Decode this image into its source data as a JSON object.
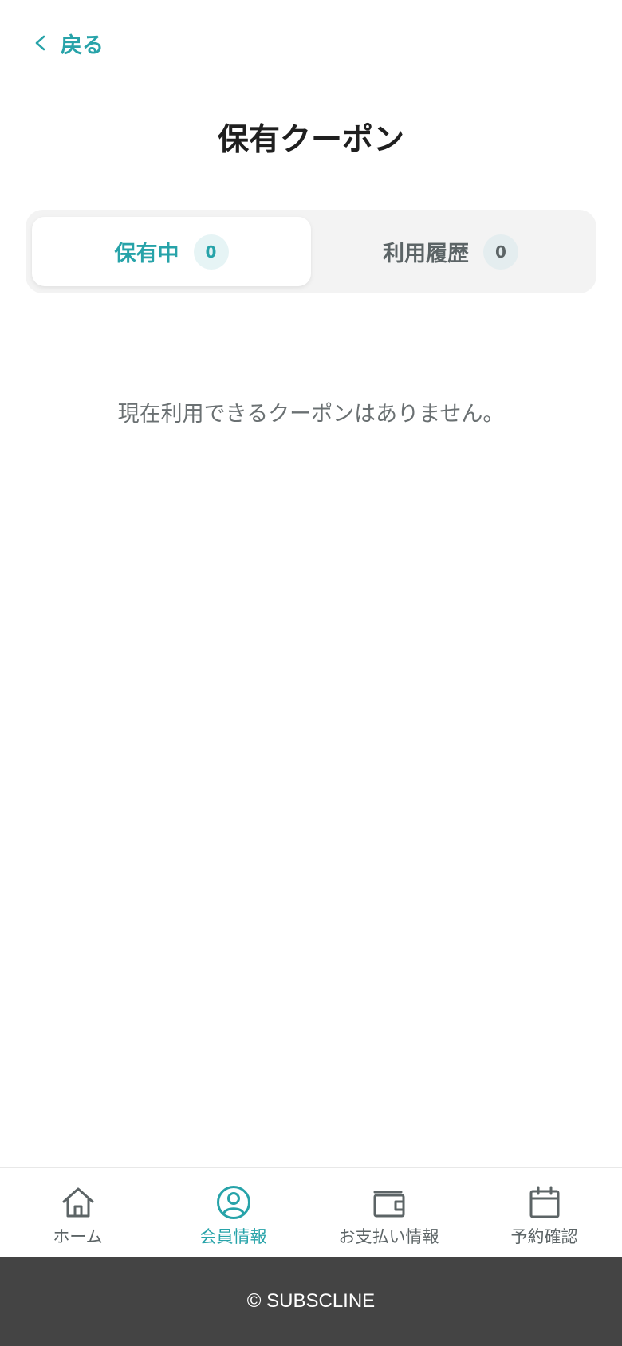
{
  "header": {
    "back_label": "戻る",
    "title": "保有クーポン"
  },
  "tabs": [
    {
      "label": "保有中",
      "count": "0",
      "active": true
    },
    {
      "label": "利用履歴",
      "count": "0",
      "active": false
    }
  ],
  "empty_message": "現在利用できるクーポンはありません。",
  "bottom_nav": [
    {
      "label": "ホーム",
      "icon": "home-icon",
      "active": false
    },
    {
      "label": "会員情報",
      "icon": "user-circle-icon",
      "active": true
    },
    {
      "label": "お支払い情報",
      "icon": "wallet-icon",
      "active": false
    },
    {
      "label": "予約確認",
      "icon": "calendar-icon",
      "active": false
    }
  ],
  "footer": {
    "copyright": "© SUBSCLINE"
  },
  "colors": {
    "accent": "#27a3a9",
    "muted": "#5c6466",
    "footer_bg": "#444444"
  }
}
